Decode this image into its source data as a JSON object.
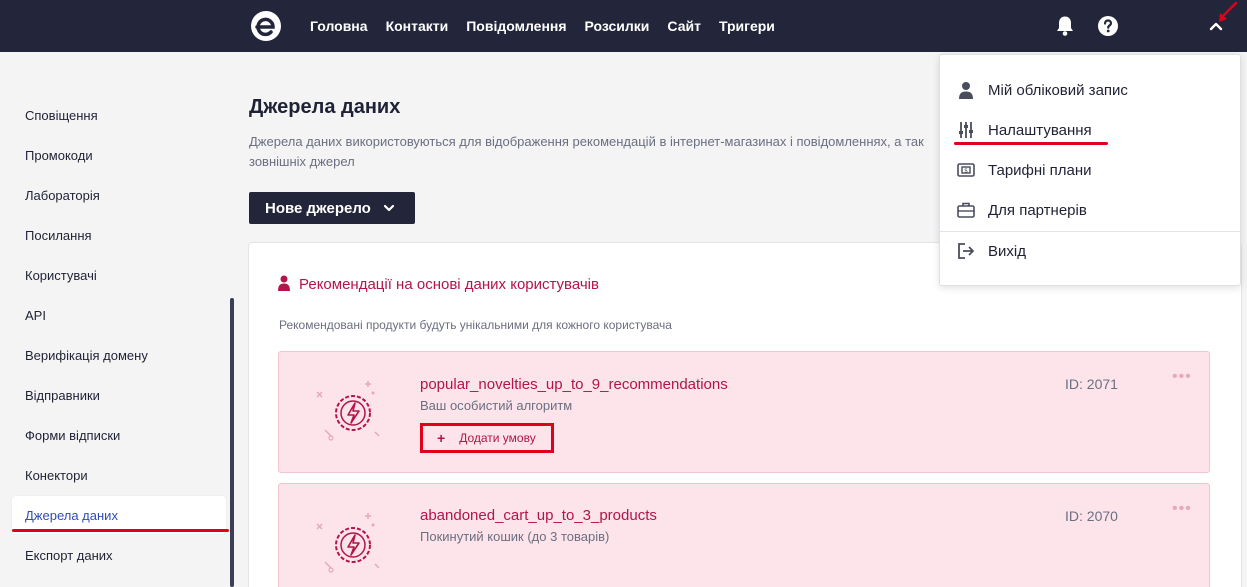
{
  "topbar": {
    "nav": [
      "Головна",
      "Контакти",
      "Повідомлення",
      "Розсилки",
      "Сайт",
      "Тригери"
    ],
    "icons": [
      "logo-icon",
      "bell-icon",
      "help-icon",
      "chevron-up-icon"
    ]
  },
  "sidebar": {
    "items": [
      "Сповіщення",
      "Промокоди",
      "Лабораторія",
      "Посилання",
      "Користувачі",
      "API",
      "Верифікація домену",
      "Відправники",
      "Форми відписки",
      "Конектори",
      "Джерела даних",
      "Експорт даних"
    ],
    "active": "Джерела даних"
  },
  "main": {
    "title": "Джерела даних",
    "description": "Джерела даних використовуються для відображення рекомендацій в інтернет-магазинах і повідомленнях, а так зовнішніх джерел",
    "new_button": "Нове джерело",
    "section_title": "Рекомендації на основі даних користувачів",
    "section_desc": "Рекомендовані продукти будуть унікальними для кожного користувача",
    "cards": [
      {
        "title": "popular_novelties_up_to_9_recommendations",
        "subtitle": "Ваш особистий алгоритм",
        "id": "ID: 2071",
        "action": "Додати умову"
      },
      {
        "title": "abandoned_cart_up_to_3_products",
        "subtitle": "Покинутий кошик (до 3 товарів)",
        "id": "ID: 2070"
      }
    ]
  },
  "dropdown": {
    "items": [
      "Мій обліковий запис",
      "Налаштування",
      "Тарифні плани",
      "Для партнерів",
      "Вихід"
    ]
  },
  "colors": {
    "topbar": "#23263a",
    "accent": "#b3144b",
    "highlight": "#e0001b",
    "card_bg": "#fce4ea"
  }
}
